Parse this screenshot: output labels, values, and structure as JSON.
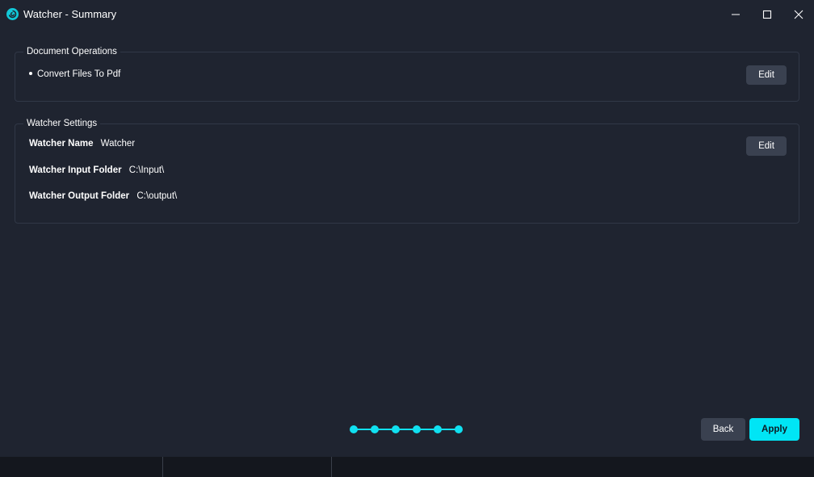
{
  "window": {
    "title": "Watcher - Summary",
    "icon": "watcher-app-icon",
    "controls": [
      "minimize-icon",
      "maximize-icon",
      "close-icon"
    ]
  },
  "document_operations": {
    "legend": "Document Operations",
    "items": [
      "Convert Files To Pdf"
    ],
    "edit_label": "Edit"
  },
  "watcher_settings": {
    "legend": "Watcher Settings",
    "edit_label": "Edit",
    "fields": [
      {
        "label": "Watcher Name",
        "value": "Watcher"
      },
      {
        "label": "Watcher Input Folder",
        "value": "C:\\Input\\"
      },
      {
        "label": "Watcher Output Folder",
        "value": "C:\\output\\"
      }
    ]
  },
  "wizard": {
    "steps_total": 6,
    "steps_completed": 6,
    "back_label": "Back",
    "apply_label": "Apply"
  },
  "colors": {
    "background": "#1f2430",
    "accent": "#00e5f5",
    "button": "#3a4150",
    "border": "#313847"
  }
}
